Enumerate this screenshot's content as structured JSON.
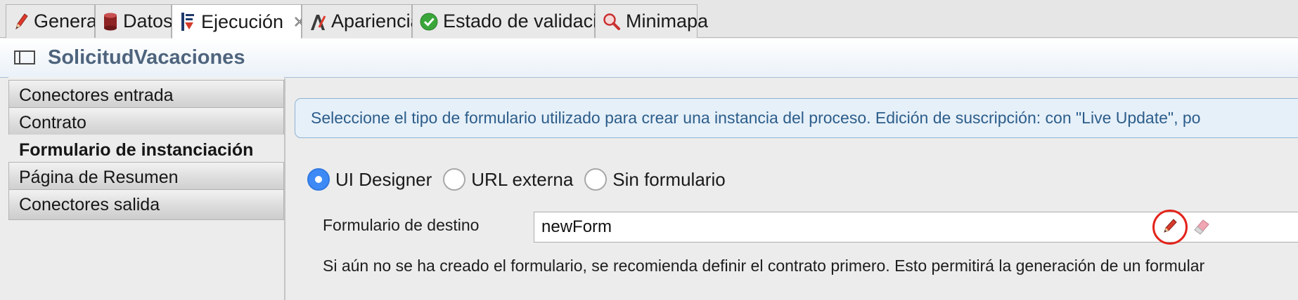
{
  "tabs": [
    {
      "label": "General",
      "icon": "pencil-icon"
    },
    {
      "label": "Datos",
      "icon": "database-icon"
    },
    {
      "label": "Ejecución",
      "icon": "execution-icon",
      "active": true,
      "close_icon": "close-icon"
    },
    {
      "label": "Apariencia",
      "icon": "appearance-icon"
    },
    {
      "label": "Estado de validación",
      "icon": "check-icon"
    },
    {
      "label": "Minimapa",
      "icon": "magnifier-icon"
    }
  ],
  "title": {
    "text": "SolicitudVacaciones",
    "icon": "panel-icon"
  },
  "sidebar": {
    "items": [
      {
        "label": "Conectores entrada"
      },
      {
        "label": "Contrato"
      },
      {
        "label": "Formulario de instanciación",
        "active": true
      },
      {
        "label": "Página de Resumen"
      },
      {
        "label": "Conectores salida"
      }
    ]
  },
  "main": {
    "info_text": "Seleccione el tipo de formulario utilizado para crear una instancia del proceso. Edición de suscripción: con \"Live Update\", po",
    "radios": [
      {
        "label": "UI Designer",
        "selected": true
      },
      {
        "label": "URL externa",
        "selected": false
      },
      {
        "label": "Sin formulario",
        "selected": false
      }
    ],
    "target_form_label": "Formulario de destino",
    "target_form_value": "newForm",
    "note": "Si aún no se ha creado el formulario, se recomienda definir el contrato primero. Esto permitirá la generación de un formular"
  },
  "colors": {
    "accent": "#3d8af7",
    "info_text": "#2c5d8a",
    "info_bg": "#e6f0f9",
    "highlight_circle": "#e3241b",
    "title_text": "#4e647d"
  }
}
